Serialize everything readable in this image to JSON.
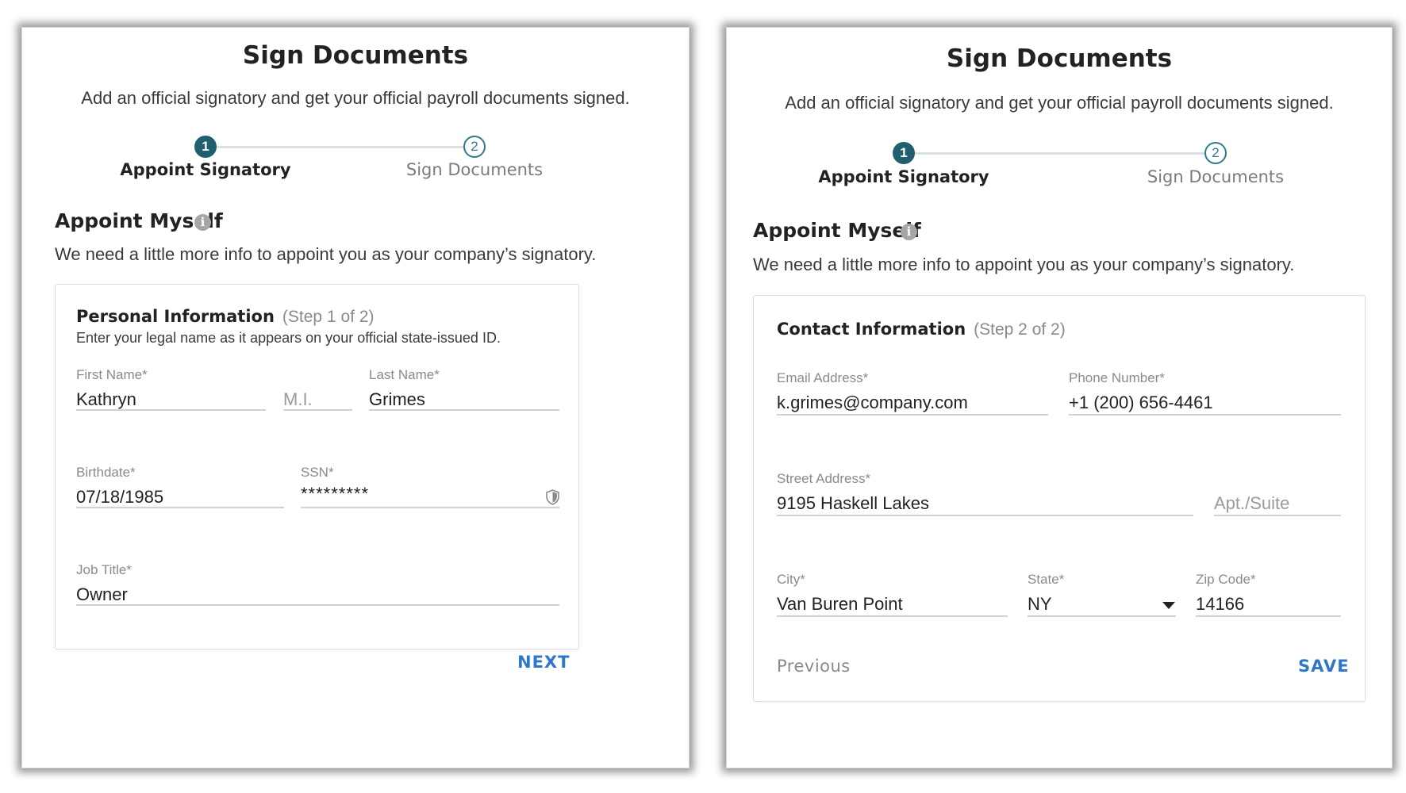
{
  "left": {
    "title": "Sign Documents",
    "subtitle": "Add an official signatory and get your official payroll documents signed.",
    "stepper": {
      "step1": {
        "number": "1",
        "label": "Appoint Signatory"
      },
      "step2": {
        "number": "2",
        "label": "Sign Documents"
      }
    },
    "section": {
      "title": "Appoint Myself",
      "info_icon": "i",
      "description": "We need a little more info to appoint you as your company’s signatory."
    },
    "card": {
      "heading": "Personal Information",
      "step": "(Step 1 of 2)",
      "description": "Enter your legal name as it appears on your official state-issued ID.",
      "fields": {
        "first_name": {
          "label": "First Name*",
          "value": "Kathryn"
        },
        "middle_initial": {
          "placeholder": "M.I."
        },
        "last_name": {
          "label": "Last Name*",
          "value": "Grimes"
        },
        "birthdate": {
          "label": "Birthdate*",
          "value": "07/18/1985"
        },
        "ssn": {
          "label": "SSN*",
          "value": "*********"
        },
        "job_title": {
          "label": "Job Title*",
          "value": "Owner"
        }
      },
      "next_label": "NEXT"
    }
  },
  "right": {
    "title": "Sign Documents",
    "subtitle": "Add an official signatory and get your official payroll documents signed.",
    "stepper": {
      "step1": {
        "number": "1",
        "label": "Appoint Signatory"
      },
      "step2": {
        "number": "2",
        "label": "Sign Documents"
      }
    },
    "section": {
      "title": "Appoint Myself",
      "info_icon": "i",
      "description": "We need a little more info to appoint you as your company’s signatory."
    },
    "card": {
      "heading": "Contact Information",
      "step": "(Step 2 of 2)",
      "fields": {
        "email": {
          "label": "Email Address*",
          "value": "k.grimes@company.com"
        },
        "phone": {
          "label": "Phone Number*",
          "value": "+1 (200) 656-4461"
        },
        "street": {
          "label": "Street Address*",
          "value": "9195 Haskell Lakes"
        },
        "apt": {
          "placeholder": "Apt./Suite"
        },
        "city": {
          "label": "City*",
          "value": "Van Buren Point"
        },
        "state": {
          "label": "State*",
          "value": "NY"
        },
        "zip": {
          "label": "Zip Code*",
          "value": "14166"
        }
      },
      "previous_label": "Previous",
      "save_label": "SAVE"
    }
  },
  "icons": {
    "info": "info-icon",
    "shield": "shield-icon",
    "caret": "caret-down-icon"
  },
  "colors": {
    "step_active": "#1f5f70",
    "step_inactive": "#2f7a8c",
    "link": "#2d78c8"
  }
}
